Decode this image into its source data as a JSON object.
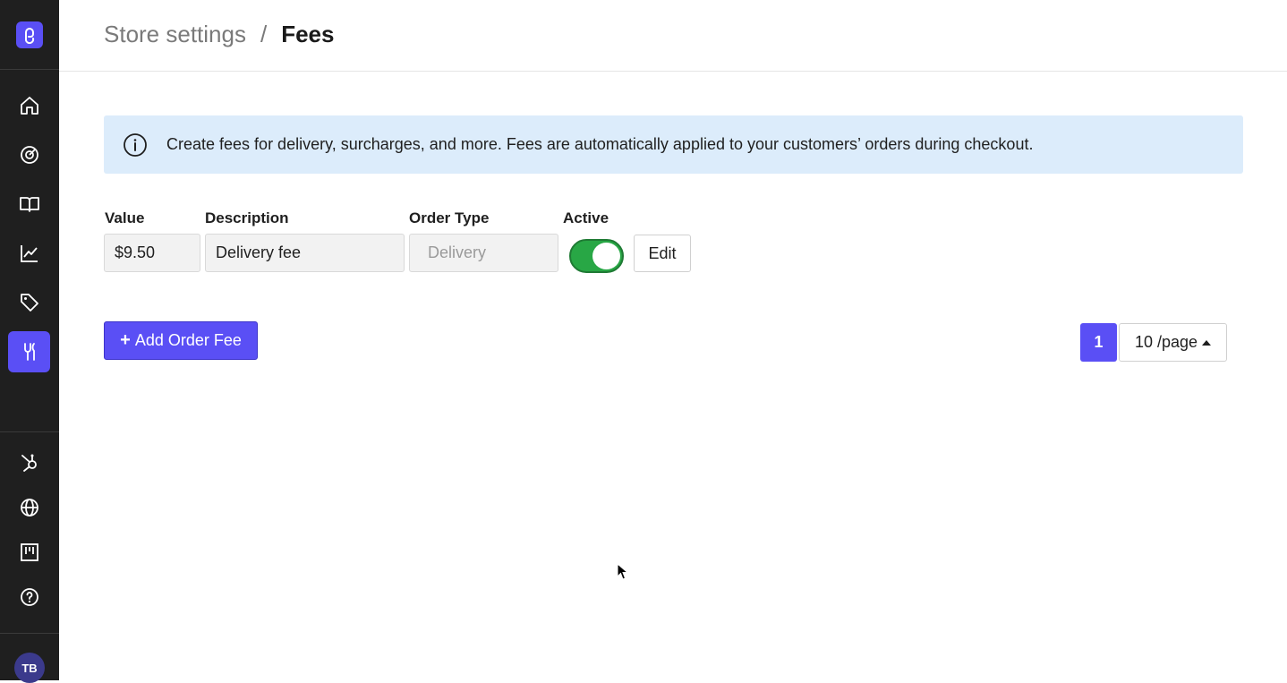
{
  "sidebar": {
    "logo": "brand-logo",
    "nav_items": [
      {
        "name": "home-icon",
        "active": false
      },
      {
        "name": "gauge-icon",
        "active": false
      },
      {
        "name": "book-icon",
        "active": false
      },
      {
        "name": "chart-icon",
        "active": false
      },
      {
        "name": "tag-icon",
        "active": false
      },
      {
        "name": "tools-icon",
        "active": true
      }
    ],
    "bottom_items": [
      {
        "name": "hubspot-icon"
      },
      {
        "name": "globe-icon"
      },
      {
        "name": "board-icon"
      },
      {
        "name": "help-icon"
      }
    ],
    "avatar_initials": "TB"
  },
  "header": {
    "breadcrumb_parent": "Store settings",
    "breadcrumb_separator": "/",
    "breadcrumb_current": "Fees"
  },
  "info_banner": {
    "text": "Create fees for delivery, surcharges, and more. Fees are automatically applied to your customers’ orders during checkout."
  },
  "fees_table": {
    "columns": {
      "value": "Value",
      "description": "Description",
      "order_type": "Order Type",
      "active": "Active"
    },
    "rows": [
      {
        "value": "$9.50",
        "description": "Delivery fee",
        "order_type": "Delivery",
        "active": true,
        "edit_label": "Edit"
      }
    ]
  },
  "actions": {
    "add_label": "Add Order Fee"
  },
  "pagination": {
    "current_page": "1",
    "page_size": "10 /page"
  },
  "colors": {
    "accent": "#5a4ff5",
    "toggle_on": "#28a745",
    "info_bg": "#dcecfb",
    "sidebar_bg": "#1f1f1f"
  }
}
